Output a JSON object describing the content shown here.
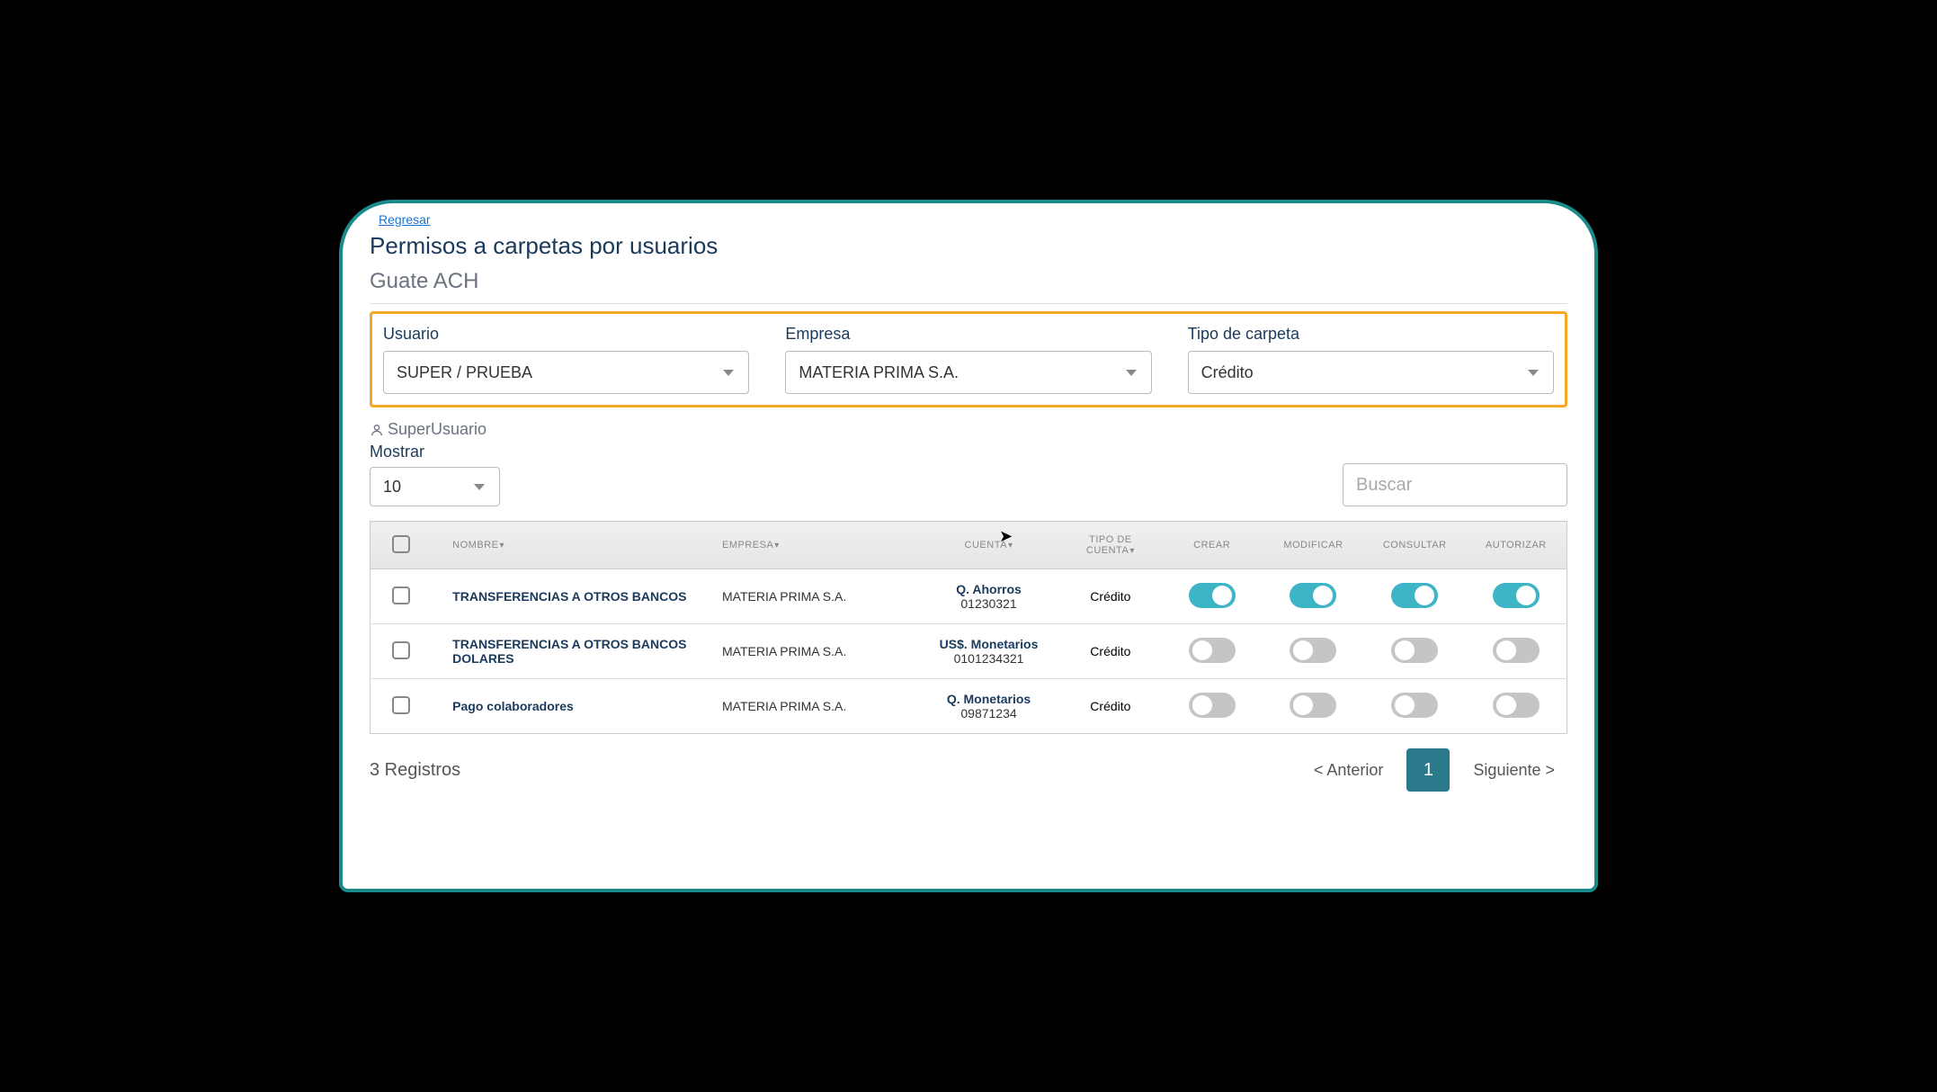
{
  "header": {
    "back_link": "Regresar",
    "title": "Permisos a carpetas por usuarios",
    "subtitle": "Guate ACH"
  },
  "filters": {
    "user": {
      "label": "Usuario",
      "value": "SUPER / PRUEBA"
    },
    "company": {
      "label": "Empresa",
      "value": "MATERIA PRIMA S.A."
    },
    "folder_type": {
      "label": "Tipo de carpeta",
      "value": "Crédito"
    }
  },
  "user_badge": "SuperUsuario",
  "toolbar": {
    "show_label": "Mostrar",
    "show_value": "10",
    "search_placeholder": "Buscar"
  },
  "columns": {
    "name": "NOMBRE",
    "company": "EMPRESA",
    "account": "CUENTA",
    "account_type": "TIPO DE CUENTA",
    "create": "CREAR",
    "modify": "MODIFICAR",
    "consult": "CONSULTAR",
    "authorize": "AUTORIZAR"
  },
  "rows": [
    {
      "name": "TRANSFERENCIAS A OTROS BANCOS",
      "company": "MATERIA PRIMA S.A.",
      "account_type_label": "Q. Ahorros",
      "account_number": "01230321",
      "folder_type": "Crédito",
      "create": true,
      "modify": true,
      "consult": true,
      "authorize": true
    },
    {
      "name": "TRANSFERENCIAS A OTROS BANCOS DOLARES",
      "company": "MATERIA PRIMA S.A.",
      "account_type_label": "US$. Monetarios",
      "account_number": "0101234321",
      "folder_type": "Crédito",
      "create": false,
      "modify": false,
      "consult": false,
      "authorize": false
    },
    {
      "name": "Pago colaboradores",
      "company": "MATERIA PRIMA S.A.",
      "account_type_label": "Q. Monetarios",
      "account_number": "09871234",
      "folder_type": "Crédito",
      "create": false,
      "modify": false,
      "consult": false,
      "authorize": false
    }
  ],
  "footer": {
    "records": "3 Registros",
    "prev": "< Anterior",
    "page": "1",
    "next": "Siguiente >"
  }
}
